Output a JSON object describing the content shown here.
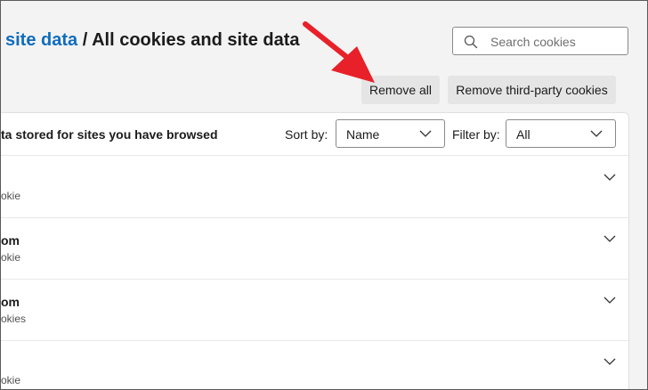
{
  "breadcrumb": {
    "link": "site data",
    "separator": " / ",
    "current": "All cookies and site data"
  },
  "search": {
    "placeholder": "Search cookies",
    "value": ""
  },
  "actions": {
    "remove_all": "Remove all",
    "remove_third_party": "Remove third-party cookies"
  },
  "list": {
    "description": "ta stored for sites you have browsed",
    "sort_label": "Sort by:",
    "sort_value": "Name",
    "filter_label": "Filter by:",
    "filter_value": "All",
    "rows": [
      {
        "name": "",
        "sub": "okie"
      },
      {
        "name": "om",
        "sub": "okie"
      },
      {
        "name": "om",
        "sub": "okies"
      },
      {
        "name": "",
        "sub": "okie"
      }
    ]
  },
  "annotation": {
    "arrow_color": "#e8202a"
  },
  "icons": {
    "search": "search-icon",
    "chevron": "chevron-down-icon"
  }
}
